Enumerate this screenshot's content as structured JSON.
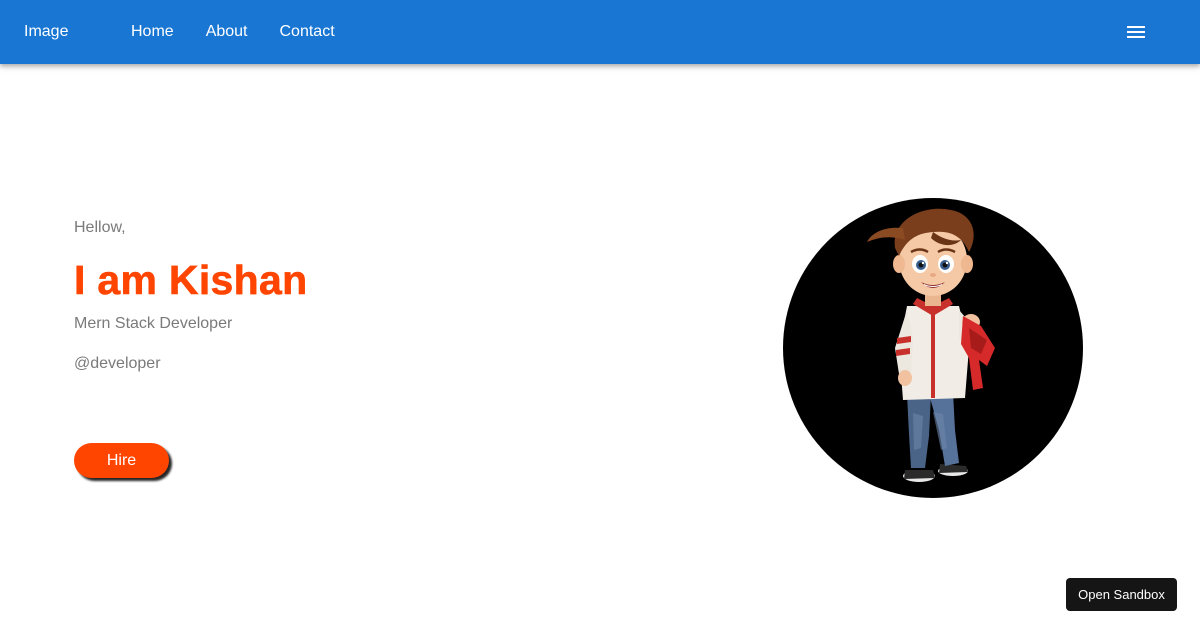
{
  "navbar": {
    "brand": "Image",
    "links": [
      "Home",
      "About",
      "Contact"
    ],
    "menu_icon": "hamburger-menu-icon",
    "background_color": "#1976d2"
  },
  "hero": {
    "greeting": "Hellow,",
    "headline": "I am Kishan",
    "role": "Mern Stack Developer",
    "handle": "@developer",
    "hire_label": "Hire",
    "accent_color": "#ff4500"
  },
  "avatar": {
    "icon": "cartoon-boy-avatar"
  },
  "sandbox": {
    "label": "Open Sandbox"
  }
}
